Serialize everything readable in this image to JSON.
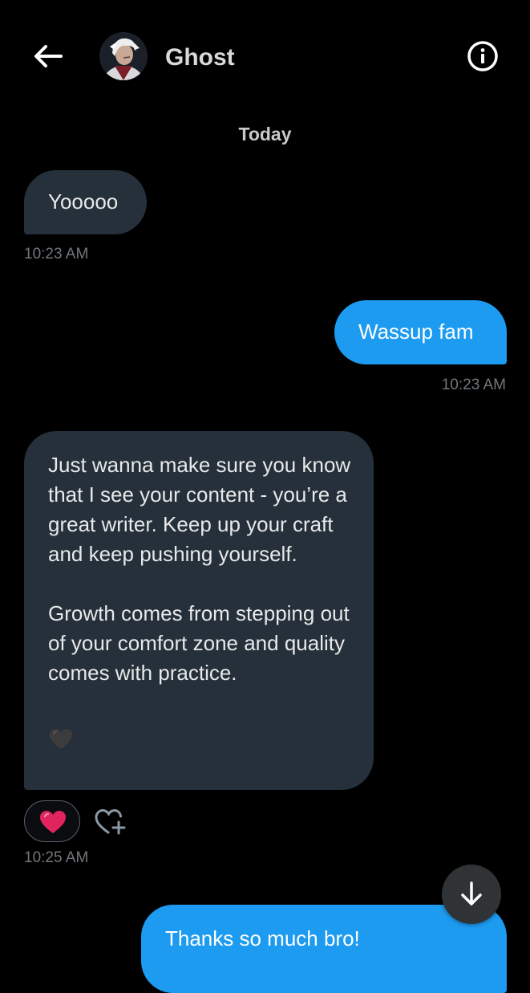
{
  "header": {
    "contact_name": "Ghost",
    "back_icon": "arrow-left-icon",
    "info_icon": "info-icon"
  },
  "conversation": {
    "day_label": "Today",
    "messages": [
      {
        "direction": "incoming",
        "paragraphs": [
          "Yooooo"
        ],
        "time": "10:23 AM"
      },
      {
        "direction": "outgoing",
        "paragraphs": [
          "Wassup fam"
        ],
        "time": "10:23 AM"
      },
      {
        "direction": "incoming",
        "paragraphs": [
          "Just wanna make sure you know that I see your content - you’re a great writer. Keep up your craft and keep pushing yourself.",
          "Growth comes from stepping out of your comfort zone and quality comes with practice."
        ],
        "inline_emoji": "black-heart",
        "reaction": "red-heart",
        "time": "10:25 AM"
      },
      {
        "direction": "outgoing",
        "paragraphs": [
          "Thanks so much bro!"
        ]
      }
    ]
  },
  "controls": {
    "add_reaction_icon": "heart-plus-icon",
    "scroll_icon": "arrow-down-icon"
  },
  "colors": {
    "background": "#000000",
    "incoming_bubble": "#25303a",
    "outgoing_bubble": "#1d9bf0",
    "timestamp": "#71767b",
    "reaction_heart": "#e0245e"
  }
}
